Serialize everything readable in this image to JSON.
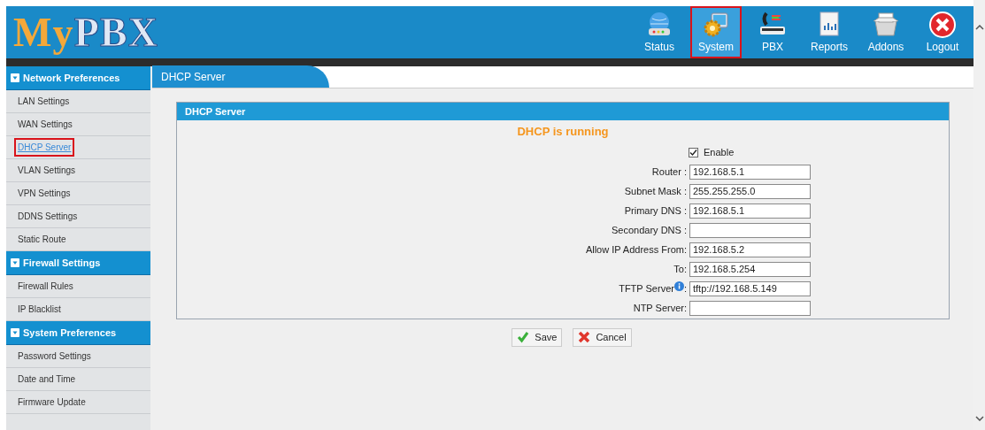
{
  "header": {
    "logo": "MyPBX",
    "nav": [
      {
        "label": "Status",
        "selected": false
      },
      {
        "label": "System",
        "selected": true
      },
      {
        "label": "PBX",
        "selected": false
      },
      {
        "label": "Reports",
        "selected": false
      },
      {
        "label": "Addons",
        "selected": false
      },
      {
        "label": "Logout",
        "selected": false
      }
    ]
  },
  "sidebar": {
    "sections": [
      {
        "title": "Network Preferences",
        "items": [
          {
            "label": "LAN Settings",
            "selected": false
          },
          {
            "label": "WAN Settings",
            "selected": false
          },
          {
            "label": "DHCP Server",
            "selected": true
          },
          {
            "label": "VLAN Settings",
            "selected": false
          },
          {
            "label": "VPN Settings",
            "selected": false
          },
          {
            "label": "DDNS Settings",
            "selected": false
          },
          {
            "label": "Static Route",
            "selected": false
          }
        ]
      },
      {
        "title": "Firewall Settings",
        "items": [
          {
            "label": "Firewall Rules",
            "selected": false
          },
          {
            "label": "IP Blacklist",
            "selected": false
          }
        ]
      },
      {
        "title": "System Preferences",
        "items": [
          {
            "label": "Password Settings",
            "selected": false
          },
          {
            "label": "Date and Time",
            "selected": false
          },
          {
            "label": "Firmware Update",
            "selected": false
          }
        ]
      }
    ]
  },
  "page_tab": "DHCP Server",
  "panel": {
    "title": "DHCP Server",
    "status": "DHCP is running",
    "enable": {
      "label": "Enable",
      "checked": true
    },
    "fields": [
      {
        "label": "Router :",
        "value": "192.168.5.1",
        "info": false
      },
      {
        "label": "Subnet Mask :",
        "value": "255.255.255.0",
        "info": false
      },
      {
        "label": "Primary DNS :",
        "value": "192.168.5.1",
        "info": false
      },
      {
        "label": "Secondary DNS :",
        "info": false
      },
      {
        "label": "Allow IP Address From:",
        "value": "192.168.5.2",
        "info": false
      },
      {
        "label": "To:",
        "value": "192.168.5.254",
        "info": false
      },
      {
        "label": "TFTP Server",
        "value": "tftp://192.168.5.149",
        "info": true,
        "label_end": ":"
      },
      {
        "label": "NTP Server:",
        "info": false
      }
    ]
  },
  "buttons": [
    {
      "label": "Save",
      "kind": "save"
    },
    {
      "label": "Cancel",
      "kind": "cancel"
    }
  ]
}
